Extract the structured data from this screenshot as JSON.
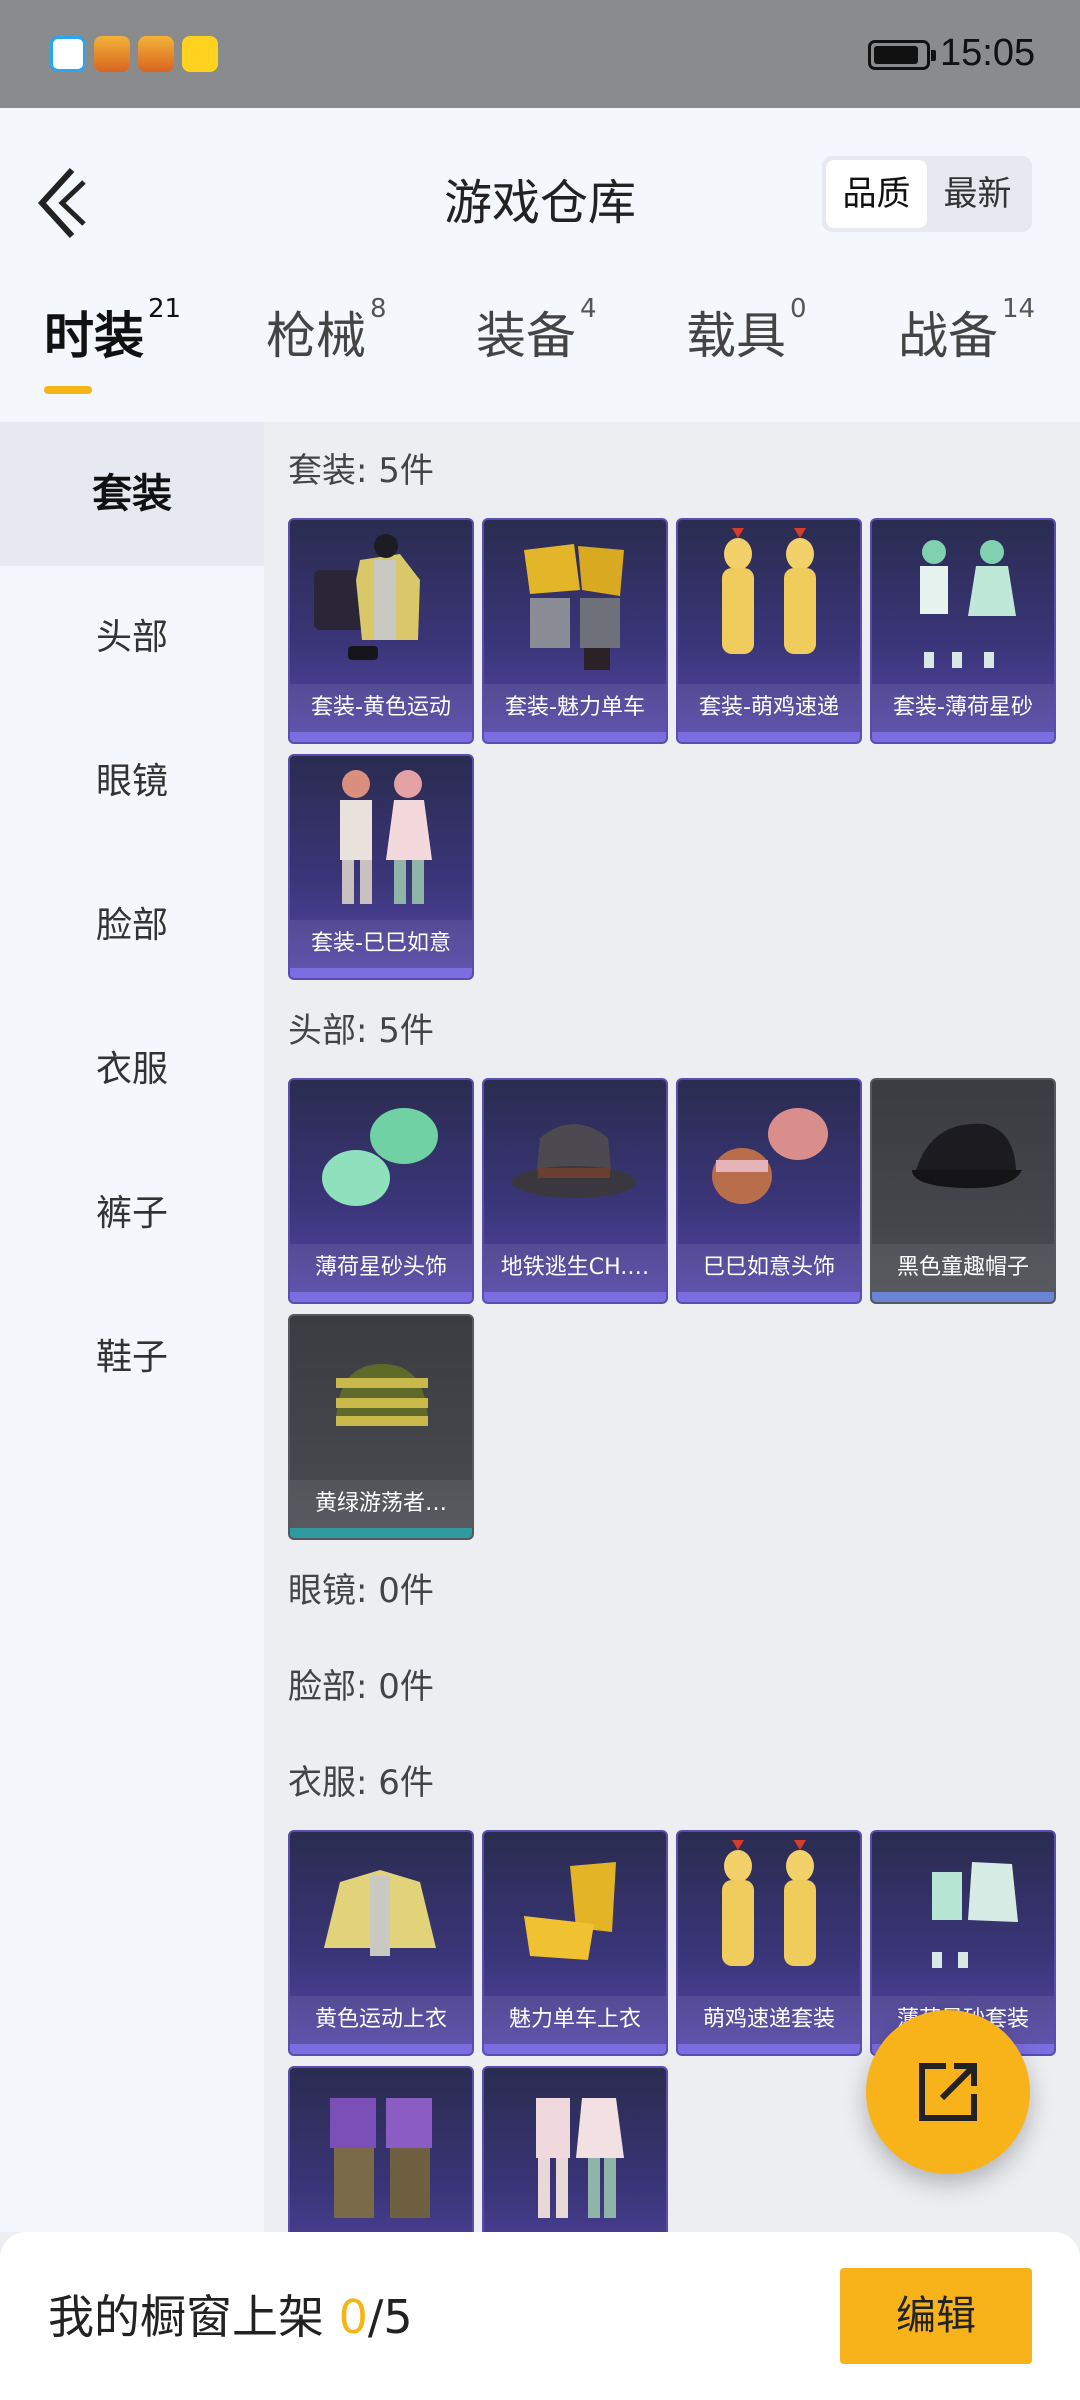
{
  "status_bar": {
    "time": "15:05"
  },
  "header": {
    "title": "游戏仓库",
    "sort": {
      "options": [
        "品质",
        "最新"
      ],
      "selected": "品质"
    }
  },
  "tabs": [
    {
      "label": "时装",
      "count": "21",
      "active": true
    },
    {
      "label": "枪械",
      "count": "8"
    },
    {
      "label": "装备",
      "count": "4"
    },
    {
      "label": "载具",
      "count": "0"
    },
    {
      "label": "战备",
      "count": "14"
    }
  ],
  "sidebar": {
    "items": [
      {
        "label": "套装",
        "active": true
      },
      {
        "label": "头部"
      },
      {
        "label": "眼镜"
      },
      {
        "label": "脸部"
      },
      {
        "label": "衣服"
      },
      {
        "label": "裤子"
      },
      {
        "label": "鞋子"
      }
    ]
  },
  "sections": [
    {
      "title": "套装: 5件",
      "items": [
        "套装-黄色运动",
        "套装-魅力单车",
        "套装-萌鸡速递",
        "套装-薄荷星砂",
        "套装-巳巳如意"
      ]
    },
    {
      "title": "头部: 5件",
      "items": [
        "薄荷星砂头饰",
        "地铁逃生CH.…",
        "巳巳如意头饰",
        "黑色童趣帽子",
        "黄绿游荡者…"
      ]
    },
    {
      "title": "眼镜: 0件",
      "items": []
    },
    {
      "title": "脸部: 0件",
      "items": []
    },
    {
      "title": "衣服: 6件",
      "items": [
        "黄色运动上衣",
        "魅力单车上衣",
        "萌鸡速递套装",
        "薄荷星砂套装",
        "",
        ""
      ]
    }
  ],
  "bottom_bar": {
    "label": "我的橱窗上架",
    "current": "0",
    "total": "/5",
    "edit_label": "编辑"
  },
  "colors": {
    "accent": "#f8b31a",
    "card_purple": "#3a3578",
    "card_gray": "#4a4c52"
  }
}
